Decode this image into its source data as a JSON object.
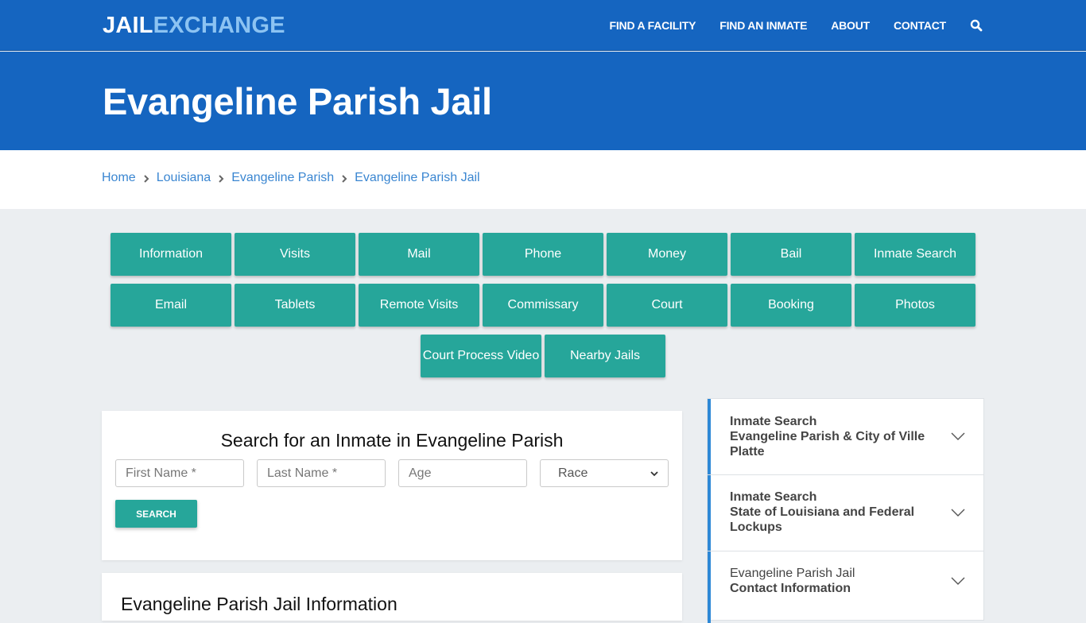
{
  "brand": {
    "part1": "JAIL",
    "part2": "EXCHANGE"
  },
  "nav": {
    "links": [
      "FIND A FACILITY",
      "FIND AN INMATE",
      "ABOUT",
      "CONTACT"
    ],
    "search_icon": "search-icon"
  },
  "hero": {
    "title": "Evangeline Parish Jail"
  },
  "breadcrumb": [
    "Home",
    "Louisiana",
    "Evangeline Parish",
    "Evangeline Parish Jail"
  ],
  "tabs": {
    "row1": [
      "Information",
      "Visits",
      "Mail",
      "Phone",
      "Money",
      "Bail",
      "Inmate Search"
    ],
    "row2": [
      "Email",
      "Tablets",
      "Remote Visits",
      "Commissary",
      "Court",
      "Booking",
      "Photos"
    ],
    "row3": [
      "Court Process Video",
      "Nearby Jails"
    ]
  },
  "search": {
    "title": "Search for an Inmate in Evangeline Parish",
    "first_name_placeholder": "First Name *",
    "last_name_placeholder": "Last Name *",
    "age_placeholder": "Age",
    "race_selected": "Race",
    "button": "SEARCH"
  },
  "info": {
    "title": "Evangeline Parish Jail Information"
  },
  "sidebar": {
    "items": [
      {
        "line1": "Inmate Search",
        "line2": "Evangeline Parish & City of Ville Platte"
      },
      {
        "line1": "Inmate Search",
        "line2": "State of Louisiana and Federal Lockups"
      },
      {
        "line1": "Evangeline Parish Jail",
        "line2": "Contact Information"
      }
    ]
  },
  "colors": {
    "primary": "#1565c0",
    "accent": "#26a69a",
    "link": "#3a86d1",
    "logo_light": "#8cc3f2"
  }
}
